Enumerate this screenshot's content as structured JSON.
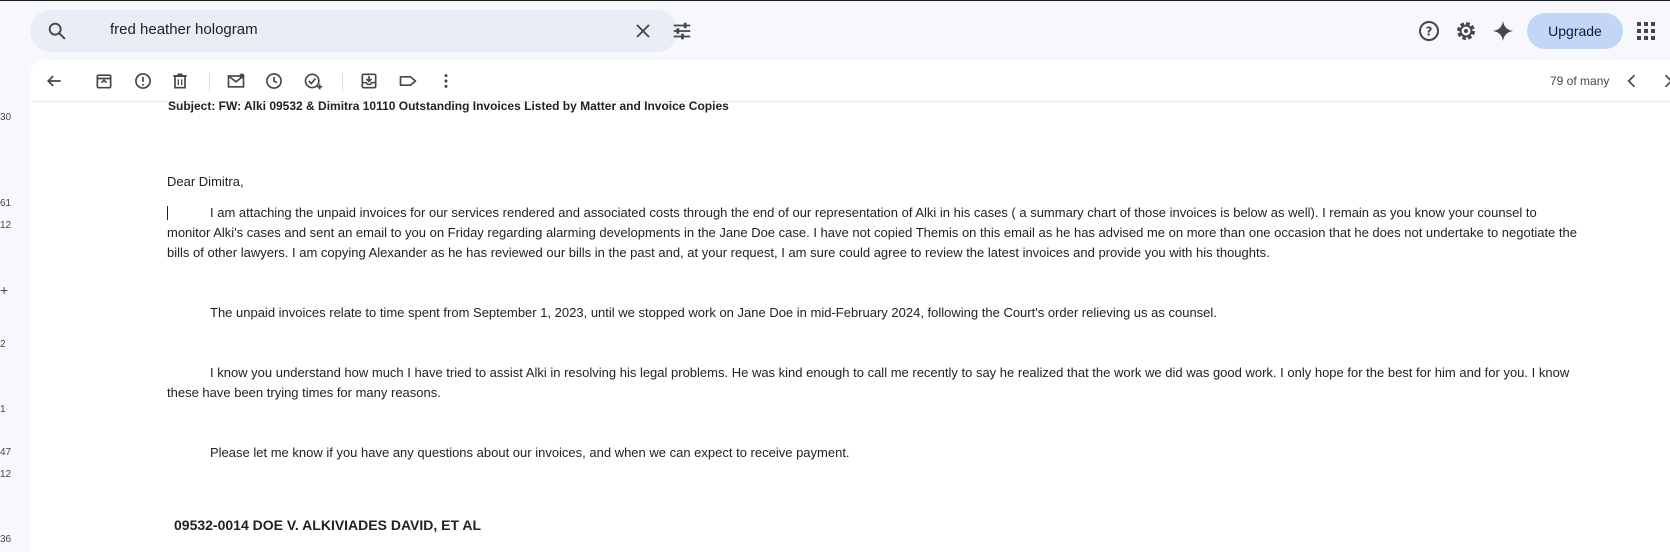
{
  "search": {
    "query": "fred heather hologram"
  },
  "header": {
    "upgrade_label": "Upgrade"
  },
  "toolbar": {
    "count_label": "79 of many"
  },
  "left_strip": {
    "items": [
      "30",
      "61",
      "12",
      "+",
      "2",
      "1",
      "47",
      "12",
      "36"
    ]
  },
  "email": {
    "subject": "Subject: FW: Alki 09532 & Dimitra 10110 Outstanding Invoices Listed by Matter and Invoice Copies",
    "greeting": "Dear Dimitra,",
    "p1_l1": "I am attaching the unpaid invoices for our services rendered and associated costs through the end of our representation of Alki in his cases ( a summary chart of those invoices is below as well).  I remain as you know your counsel to",
    "p1_l2": "monitor Alki's cases and sent an email to you on Friday regarding alarming developments in the Jane Doe case.  I have not copied Themis on this email as he has advised me on more than one occasion that he does not undertake to negotiate the",
    "p1_l3": "bills of other lawyers.  I am copying Alexander as he has reviewed our bills in the past and, at your request, I am sure could agree to review the latest invoices and provide you with his thoughts.",
    "p2_l1": "The unpaid invoices relate to time spent from September 1, 2023, until we stopped work on Jane Doe in mid-February 2024, following the Court's order relieving us as counsel.",
    "p3_l1": "I know you understand how much I have tried to assist Alki in resolving his legal problems.  He was kind enough to call me recently to say he realized that the work we did was good work.  I only hope for the best for him and for you.  I know",
    "p3_l2": "these have been trying times for many reasons.",
    "p4_l1": "Please let me know if you have any questions about our invoices, and when we can expect to receive payment.",
    "matter_heading": "09532-0014 DOE V. ALKIVIADES DAVID, ET AL"
  }
}
